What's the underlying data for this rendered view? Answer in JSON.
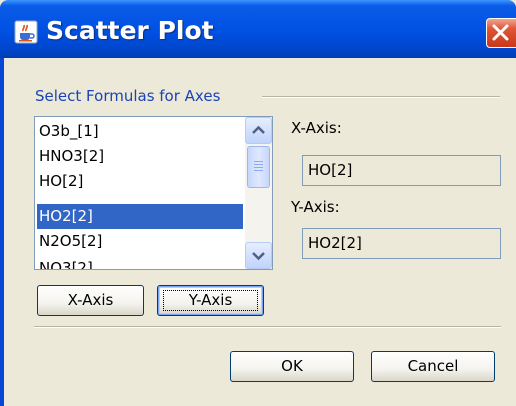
{
  "window": {
    "title": "Scatter Plot"
  },
  "group": {
    "title": "Select Formulas for Axes"
  },
  "formula_list": {
    "items": [
      "O3b_[1]",
      "HNO3[2]",
      "HO[2]",
      "HO2[2]",
      "N2O5[2]",
      "NO3[2]"
    ],
    "selected_index": 3
  },
  "x_axis": {
    "label": "X-Axis:",
    "value": "HO[2]"
  },
  "y_axis": {
    "label": "Y-Axis:",
    "value": "HO2[2]"
  },
  "buttons": {
    "set_x": "X-Axis",
    "set_y": "Y-Axis",
    "ok": "OK",
    "cancel": "Cancel"
  },
  "colors": {
    "titlebar": "#0050e2",
    "selection": "#3165c6",
    "group_title": "#1a43b8",
    "close_button": "#e05636"
  },
  "icons": [
    "java-cup-icon",
    "close-icon",
    "scroll-up-icon",
    "scroll-down-icon"
  ]
}
